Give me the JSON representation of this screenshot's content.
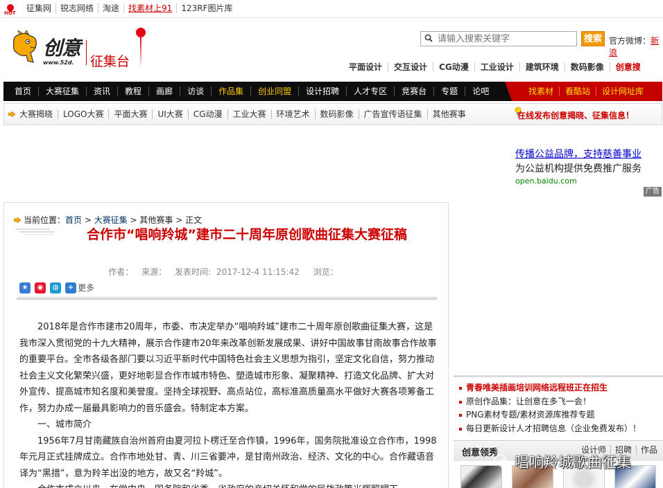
{
  "topbar": {
    "hot_label": "HOT",
    "links": [
      "征集网",
      "锐志网络",
      "淘途",
      "找素材上91",
      "123RF图片库"
    ],
    "highlight_index": 3
  },
  "header": {
    "logo_text": "创意",
    "logo_url": "www.52d.",
    "logo_sub": "征集台",
    "search_placeholder": "请输入搜索关键字",
    "search_button": "搜索",
    "weibo_label": "官方微博：",
    "weibo_link": "新浪",
    "categories": [
      "平面设计",
      "交互设计",
      "CG动漫",
      "工业设计",
      "建筑环境",
      "数码影像",
      "创意搜"
    ]
  },
  "mainnav": {
    "items": [
      "首页",
      "大赛征集",
      "资讯",
      "教程",
      "画廊",
      "访谈",
      "作品集",
      "创业同盟",
      "设计招聘",
      "人才专区",
      "竞赛台",
      "专题",
      "论吧"
    ],
    "highlighted": [
      6,
      7
    ],
    "right_items": [
      "找素材",
      "看酷站",
      "设计网址库"
    ]
  },
  "subnav": {
    "items": [
      "大赛揭晓",
      "LOGO大赛",
      "平面大赛",
      "UI大赛",
      "CG动漫",
      "工业大赛",
      "环境艺术",
      "数码影像",
      "广告宣传语征集",
      "其他赛事"
    ],
    "notice": "在线发布创意揭晓、征集信息！"
  },
  "ad": {
    "line1": "传播公益品牌，支持慈善事业",
    "line2": "为公益机构提供免费推广服务",
    "line3": "open.baidu.com",
    "badge": "广告"
  },
  "article": {
    "breadcrumb_label": "当前位置：",
    "breadcrumb": [
      "首页",
      "大赛征集",
      "其他赛事",
      "正文"
    ],
    "breadcrumb_sep": " > ",
    "title": "合作市“唱响羚城”建市二十周年原创歌曲征集大赛征稿",
    "author_label": "作者：",
    "source_label": "来源：",
    "date_label": "发表时间:",
    "date": "2017-12-4 11:15:42",
    "views_label": "浏览：",
    "share_more": "更多",
    "paragraphs": [
      "2018年是合作市建市20周年，市委、市决定举办“唱响羚城”建市二十周年原创歌曲征集大赛，这是我市深入贯彻党的十九大精神，展示合作建市20年来改革创新发展成果、讲好中国故事甘南故事合作故事的重要平台。全市各级各部门要以习近平新时代中国特色社会主义思想为指引，坚定文化自信，努力推动社会主义文化繁荣兴盛，更好地彰显合作市城市特色、塑造城市形象、凝聚精神、打造文化品牌、扩大对外宣传、提高城市知名度和美誉度。坚持全球视野、高点站位，高标准高质量高水平做好大赛各项筹备工作，努力办成一届最具影响力的音乐盛会。特制定本方案。",
      "一、城市简介",
      "1956年7月甘南藏族自治州首府由夏河拉卜楞迁至合作镇，1996年，国务院批准设立合作市，1998年元月正式挂牌成立。合作市地处甘、青、川三省要冲，是甘南州政治、经济、文化的中心。合作藏语音译为“黑措”，意为羚羊出没的地方，故又名“羚城”。",
      "合作市成立以来，在党中央、国务院和省委、省政府的亲切关怀和党的民族政策光辉照耀下，"
    ]
  },
  "sidebox": {
    "items": [
      "青春唯美插画培训网络远程班正在招生",
      "原创作品集：让创意在多飞一会！",
      "PNG素材专题/素材资源库推荐专题",
      "每日更新设计人才招聘信息（企业免费发布）！"
    ]
  },
  "creative": {
    "title": "创意领秀",
    "tabs": [
      "设计师",
      "招聘",
      "作品"
    ]
  },
  "watermark": {
    "text": "唱响羚城歌曲征集"
  },
  "colors": {
    "accent_red": "#c40000",
    "nav_black": "#0d0d0d",
    "search_orange": "#f39800"
  }
}
